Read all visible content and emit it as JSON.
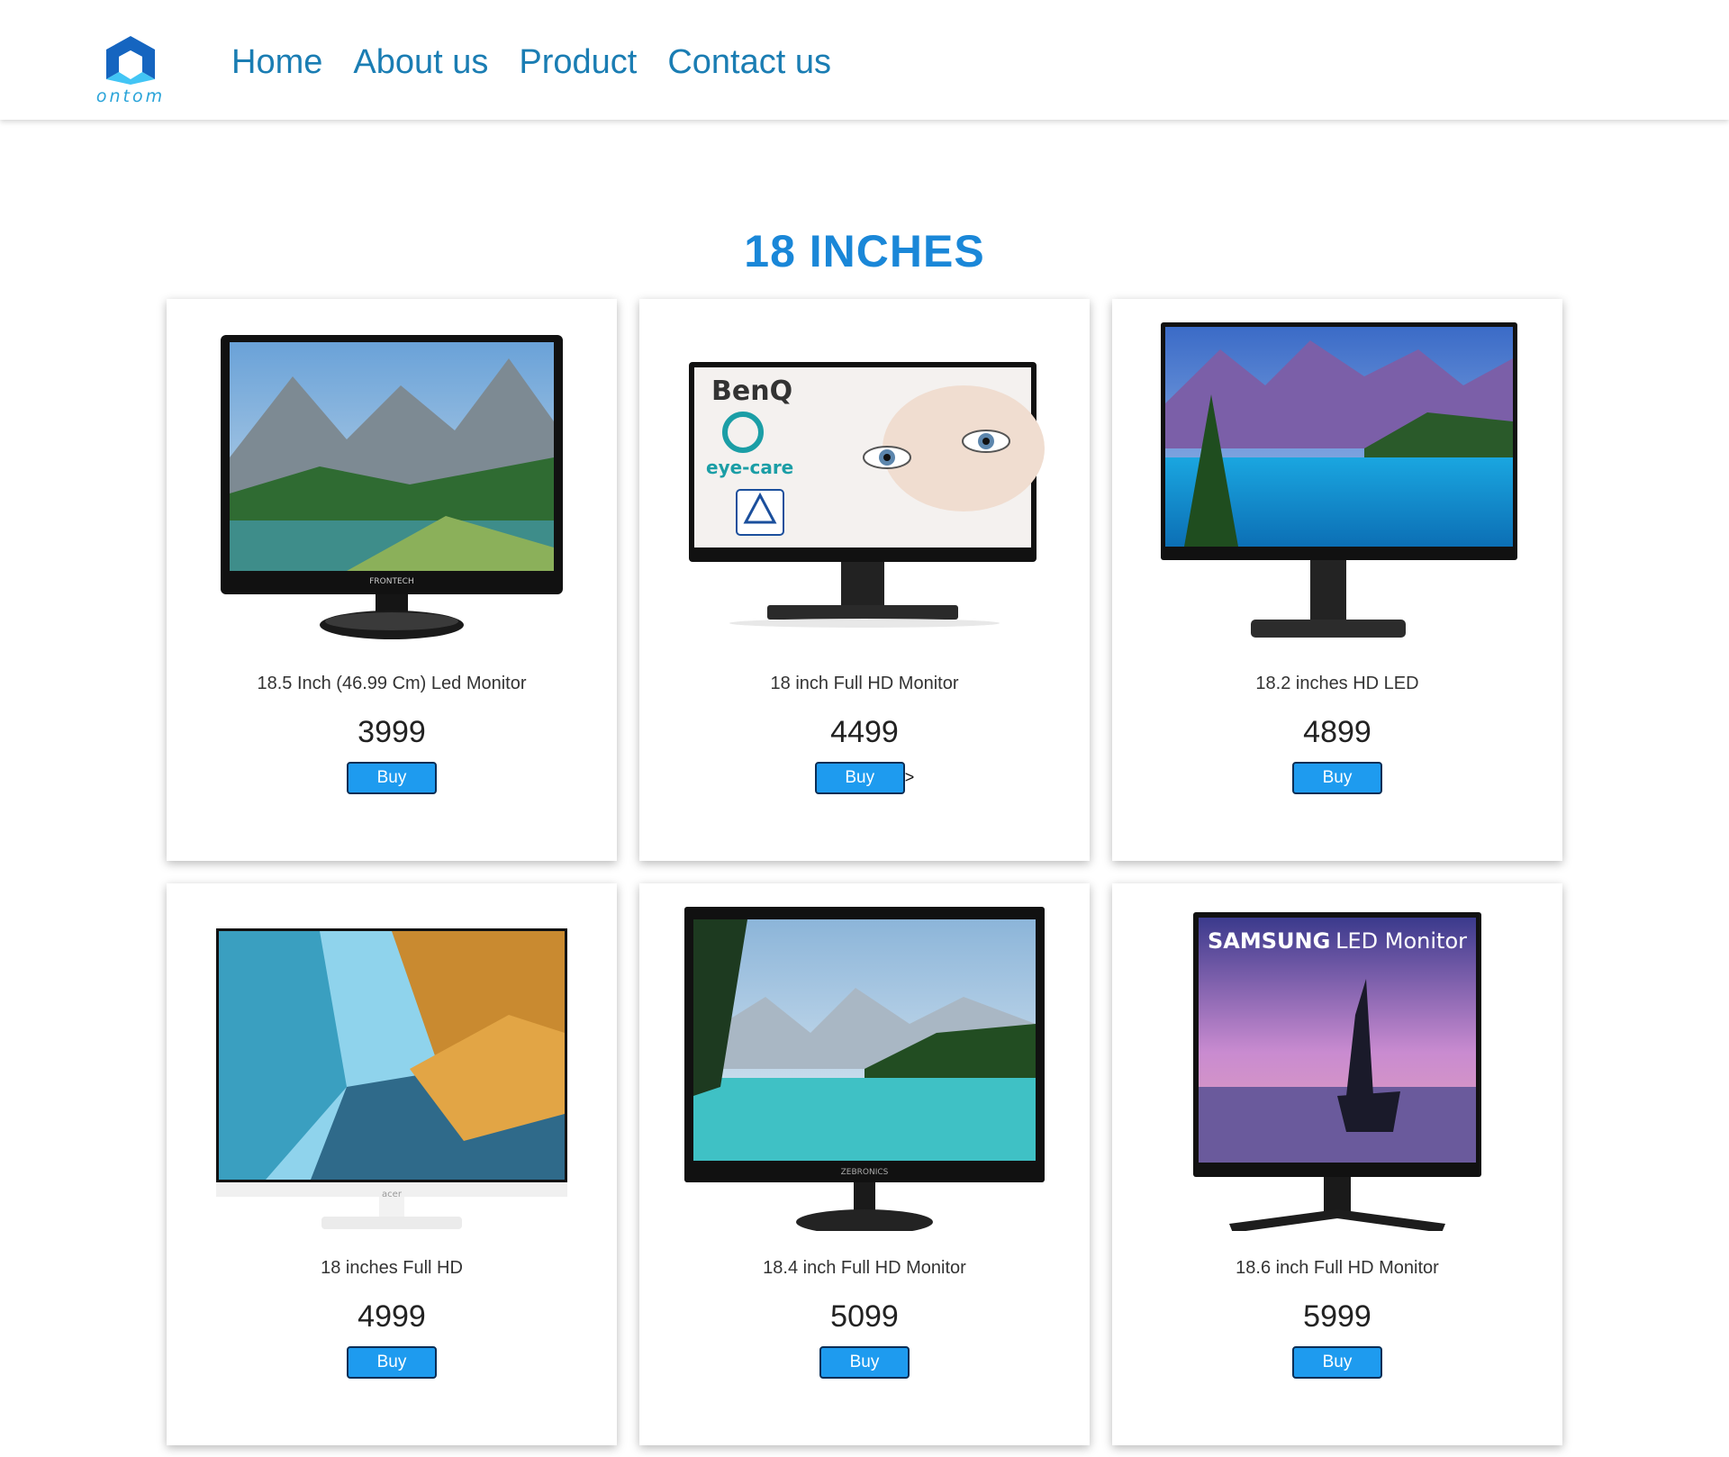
{
  "brand": {
    "logo_text": "ontom"
  },
  "nav": [
    {
      "label": "Home"
    },
    {
      "label": "About us"
    },
    {
      "label": "Product"
    },
    {
      "label": "Contact us"
    }
  ],
  "section": {
    "title": "18 INCHES"
  },
  "products": [
    {
      "name": "18.5 Inch (46.99 Cm) Led Monitor",
      "price": "3999",
      "buy_label": "Buy",
      "brand_text": "FRONTECH"
    },
    {
      "name": "18 inch Full HD Monitor",
      "price": "4499",
      "buy_label": "Buy",
      "extra": ">",
      "brand_text": "BenQ",
      "badge_text": "eye-care"
    },
    {
      "name": "18.2 inches HD LED",
      "price": "4899",
      "buy_label": "Buy"
    },
    {
      "name": "18 inches Full HD",
      "price": "4999",
      "buy_label": "Buy",
      "brand_text": "acer"
    },
    {
      "name": "18.4 inch Full HD Monitor",
      "price": "5099",
      "buy_label": "Buy",
      "brand_text": "ZEBRONICS"
    },
    {
      "name": "18.6 inch Full HD Monitor",
      "price": "5999",
      "buy_label": "Buy",
      "brand_text": "SAMSUNG",
      "badge_text": "LED Monitor"
    }
  ],
  "colors": {
    "nav": "#1a7db3",
    "title": "#1a87d8",
    "button": "#1e9bef"
  }
}
